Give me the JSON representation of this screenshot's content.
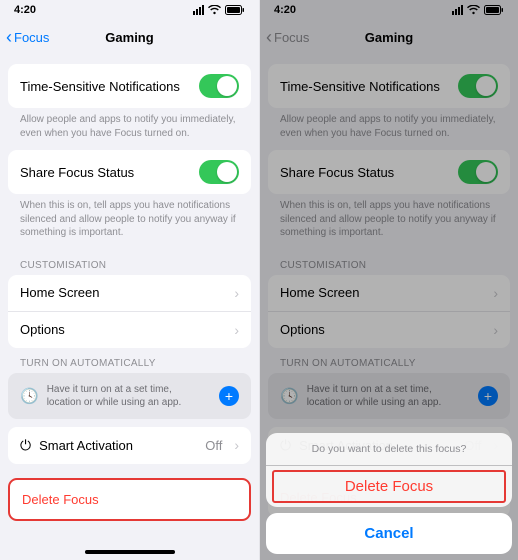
{
  "status": {
    "time": "4:20"
  },
  "nav": {
    "back_label": "Focus",
    "title": "Gaming"
  },
  "timeSensitive": {
    "label": "Time-Sensitive Notifications",
    "footer": "Allow people and apps to notify you immediately, even when you have Focus turned on."
  },
  "shareStatus": {
    "label": "Share Focus Status",
    "footer": "When this is on, tell apps you have notifications silenced and allow people to notify you anyway if something is important."
  },
  "customisation": {
    "header": "CUSTOMISATION",
    "home_screen": "Home Screen",
    "options": "Options"
  },
  "auto": {
    "header": "TURN ON AUTOMATICALLY",
    "hint": "Have it turn on at a set time, location or while using an app.",
    "smart_label": "Smart Activation",
    "smart_value": "Off"
  },
  "delete": {
    "label": "Delete Focus"
  },
  "sheet": {
    "prompt": "Do you want to delete this focus?",
    "delete": "Delete Focus",
    "cancel": "Cancel"
  }
}
